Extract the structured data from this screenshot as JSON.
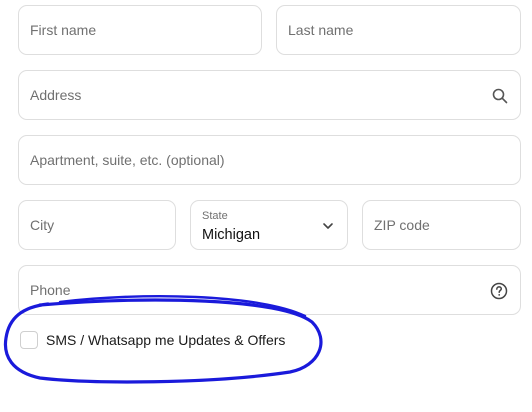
{
  "form": {
    "first_name": {
      "placeholder": "First name",
      "value": ""
    },
    "last_name": {
      "placeholder": "Last name",
      "value": ""
    },
    "address": {
      "placeholder": "Address",
      "value": "",
      "icon": "search-icon"
    },
    "apartment": {
      "placeholder": "Apartment, suite, etc. (optional)",
      "value": ""
    },
    "city": {
      "placeholder": "City",
      "value": ""
    },
    "state": {
      "label": "State",
      "value": "Michigan",
      "icon": "chevron-down-icon"
    },
    "zip": {
      "placeholder": "ZIP code",
      "value": ""
    },
    "phone": {
      "placeholder": "Phone",
      "value": "",
      "icon": "help-circle-icon"
    },
    "sms_optin": {
      "label": "SMS / Whatsapp me Updates & Offers",
      "checked": false
    }
  },
  "annotation": {
    "color": "#1a1adb"
  }
}
